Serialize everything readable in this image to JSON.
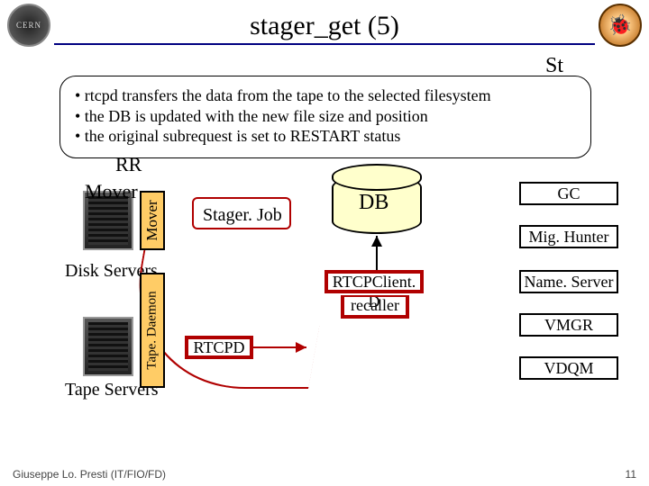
{
  "title": "stager_get (5)",
  "logo_left": "CERN",
  "logo_right": "🐞",
  "callout": {
    "line1": "• rtcpd transfers the data from the tape to the selected filesystem",
    "line2": "• the DB is updated with the new file size and position",
    "line3": "• the original subrequest is set to RESTART status"
  },
  "stager_peek": "St",
  "rr": "RR",
  "mover": "Mover",
  "mover_vert": "Mover",
  "tapedaemon_vert": "Tape. Daemon",
  "disk_servers": "Disk Servers",
  "tape_servers": "Tape Servers",
  "stagerjob": "Stager. Job",
  "db": "DB",
  "rtcpclientd": "RTCPClient. D",
  "recaller": "recaller",
  "rtcpd": "RTCPD",
  "services": {
    "gc": "GC",
    "mighunter": "Mig. Hunter",
    "nameserver": "Name. Server",
    "vmgr": "VMGR",
    "vdqm": "VDQM"
  },
  "footer": "Giuseppe Lo. Presti (IT/FIO/FD)",
  "page": "11"
}
